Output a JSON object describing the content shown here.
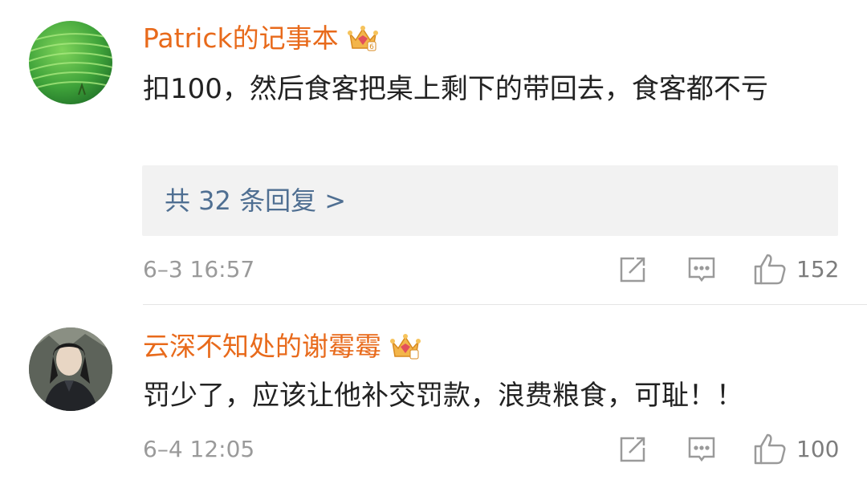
{
  "comments": [
    {
      "username": "Patrick的记事本",
      "text": "扣100，然后食客把桌上剩下的带回去，食客都不亏",
      "replies_label": "共 32 条回复 >",
      "time": "6–3 16:57",
      "likes": "152",
      "badge_icon": "crown-icon",
      "avatar_icon": "green-field-avatar"
    },
    {
      "username": "云深不知处的谢霉霉",
      "text": "罚少了，应该让他补交罚款，浪费粮食，可耻！！",
      "time": "6–4 12:05",
      "likes": "100",
      "badge_icon": "crown-icon",
      "avatar_icon": "person-avatar"
    }
  ],
  "colors": {
    "username": "#e86a1b",
    "text": "#222222",
    "link": "#4f6f92",
    "meta": "#9a9a9a",
    "reply_bg": "#f2f2f2"
  }
}
